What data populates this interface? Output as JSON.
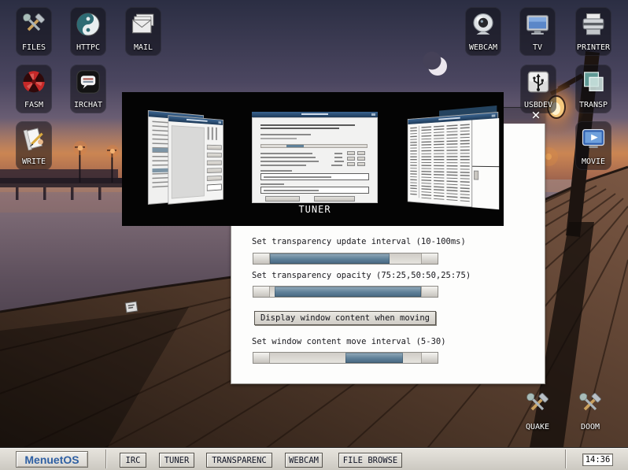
{
  "colors": {
    "accent_blue": "#5e8098",
    "title_navy": "#2c4f72",
    "taskbar_bg": "#d8d4cc",
    "menuetos_blue": "#2e5fa3"
  },
  "desktop": {
    "icons": [
      {
        "label": "FILES",
        "icon": "hammer-wrench-icon"
      },
      {
        "label": "HTTPC",
        "icon": "yinyang-icon"
      },
      {
        "label": "MAIL",
        "icon": "envelope-icon"
      },
      {
        "label": "WEBCAM",
        "icon": "webcam-icon"
      },
      {
        "label": "TV",
        "icon": "tv-icon"
      },
      {
        "label": "PRINTER",
        "icon": "printer-icon"
      },
      {
        "label": "FASM",
        "icon": "red-fan-icon"
      },
      {
        "label": "IRCHAT",
        "icon": "chat-bubble-icon"
      },
      {
        "label": "USBDEV",
        "icon": "usb-icon"
      },
      {
        "label": "TRANSP",
        "icon": "overlap-squares-icon"
      },
      {
        "label": "WRITE",
        "icon": "scroll-pen-icon"
      },
      {
        "label": "MOVIE",
        "icon": "movie-player-icon"
      },
      {
        "label": "QUAKE",
        "icon": "hammer-wrench-icon"
      },
      {
        "label": "DOOM",
        "icon": "hammer-wrench-icon"
      }
    ]
  },
  "window_switcher": {
    "selected_app": "TUNER"
  },
  "transparency_window": {
    "close_icon": "×",
    "sliders": [
      {
        "label": "Set transparency update interval (10-100ms)",
        "fill_start": 0,
        "fill_end": 79
      },
      {
        "label": "Set transparency opacity (75:25,50:50,25:75)",
        "fill_start": 3,
        "fill_end": 100
      },
      {
        "label": "Set window content move interval (5-30)",
        "fill_start": 50,
        "fill_end": 88
      }
    ],
    "move_button_label": "Display window content when moving"
  },
  "taskbar": {
    "start_button": "MenuetOS",
    "tasks": [
      "IRC",
      "TUNER",
      "TRANSPARENC",
      "WEBCAM",
      "FILE BROWSE"
    ],
    "clock": "14:36"
  }
}
